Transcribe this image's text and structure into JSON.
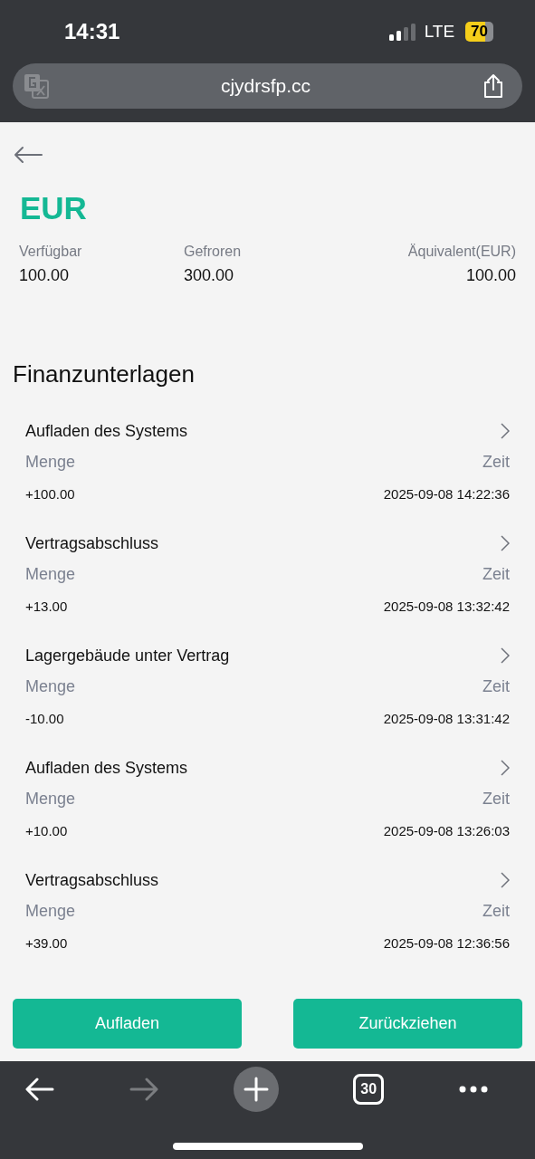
{
  "status_bar": {
    "time": "14:31",
    "network": "LTE",
    "battery": "70"
  },
  "address_bar": {
    "url": "cjydrsfp.cc"
  },
  "currency": "EUR",
  "balances": [
    {
      "label": "Verfügbar",
      "value": "100.00"
    },
    {
      "label": "Gefroren",
      "value": "300.00"
    },
    {
      "label": "Äquivalent(EUR)",
      "value": "100.00"
    }
  ],
  "records_title": "Finanzunterlagen",
  "records": [
    {
      "title": "Aufladen des Systems",
      "amount_label": "Menge",
      "time_label": "Zeit",
      "amount": "+100.00",
      "time": "2025-09-08 14:22:36"
    },
    {
      "title": "Vertragsabschluss",
      "amount_label": "Menge",
      "time_label": "Zeit",
      "amount": "+13.00",
      "time": "2025-09-08 13:32:42"
    },
    {
      "title": "Lagergebäude unter Vertrag",
      "amount_label": "Menge",
      "time_label": "Zeit",
      "amount": "-10.00",
      "time": "2025-09-08 13:31:42"
    },
    {
      "title": "Aufladen des Systems",
      "amount_label": "Menge",
      "time_label": "Zeit",
      "amount": "+10.00",
      "time": "2025-09-08 13:26:03"
    },
    {
      "title": "Vertragsabschluss",
      "amount_label": "Menge",
      "time_label": "Zeit",
      "amount": "+39.00",
      "time": "2025-09-08 12:36:56"
    }
  ],
  "actions": [
    "Aufladen",
    "Zurückziehen"
  ],
  "browser_toolbar": {
    "forward_disabled": true,
    "tab_count": "30"
  }
}
